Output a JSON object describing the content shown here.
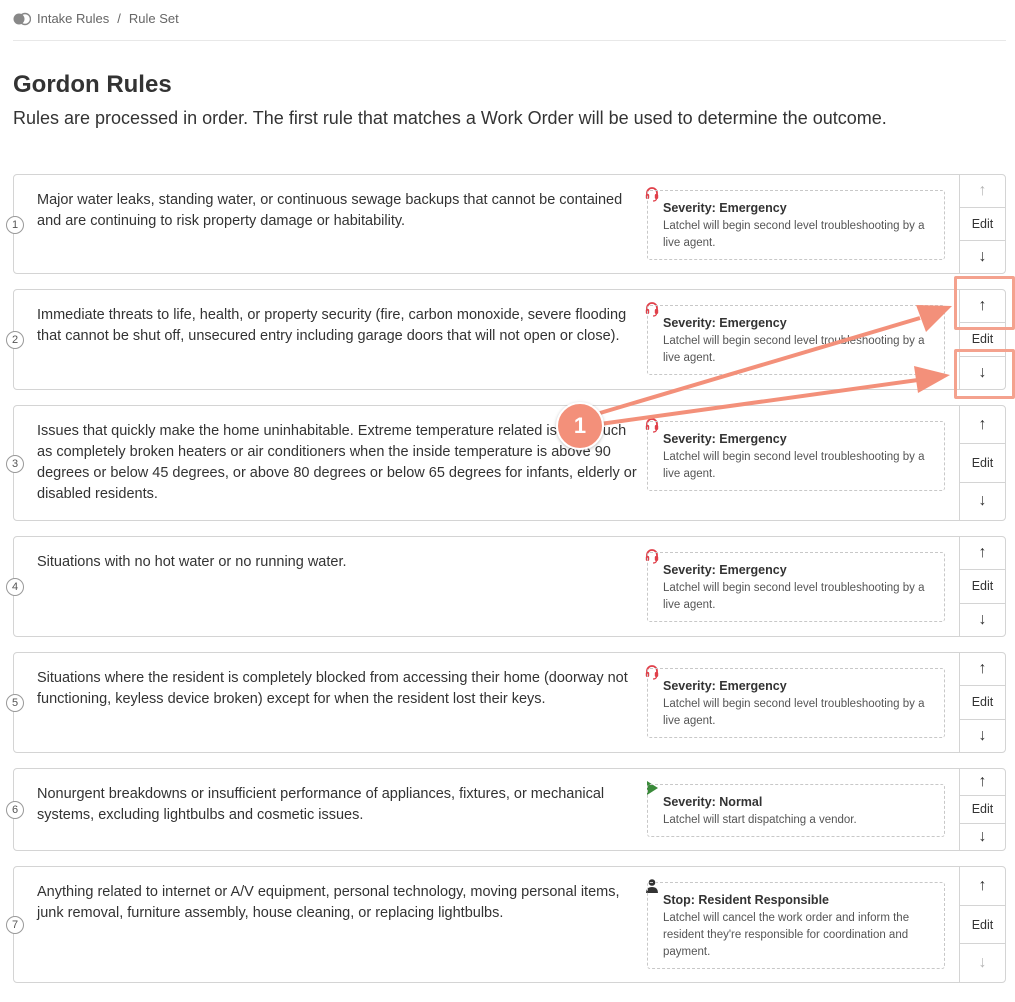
{
  "breadcrumb": {
    "items": [
      "Intake Rules",
      "Rule Set"
    ],
    "separator": "/"
  },
  "page": {
    "title": "Gordon Rules",
    "subtitle": "Rules are processed in order. The first rule that matches a Work Order will be used to determine the outcome."
  },
  "edit_label": "Edit",
  "colors": {
    "emergency": "#e0404a",
    "normal": "#3a8a3a",
    "stop": "#333333",
    "annotation": "#f3907a"
  },
  "rules": [
    {
      "num": "1",
      "desc": "Major water leaks, standing water, or continuous sewage backups that cannot be contained and are continuing to risk property damage or habitability.",
      "icon": "headset-icon",
      "card_title": "Severity: Emergency",
      "card_text": "Latchel will begin second level troubleshooting by a live agent."
    },
    {
      "num": "2",
      "desc": "Immediate threats to life, health, or property security (fire, carbon monoxide, severe flooding that cannot be shut off, unsecured entry including garage doors that will not open or close).",
      "icon": "headset-icon",
      "card_title": "Severity: Emergency",
      "card_text": "Latchel will begin second level troubleshooting by a live agent."
    },
    {
      "num": "3",
      "desc": "Issues that quickly make the home uninhabitable. Extreme temperature related issues, such as completely broken heaters or air conditioners when the inside temperature is above 90 degrees or below 45 degrees, or above 80 degrees or below 65 degrees for infants, elderly or disabled residents.",
      "icon": "headset-icon",
      "card_title": "Severity: Emergency",
      "card_text": "Latchel will begin second level troubleshooting by a live agent."
    },
    {
      "num": "4",
      "desc": "Situations with no hot water or no running water.",
      "icon": "headset-icon",
      "card_title": "Severity: Emergency",
      "card_text": "Latchel will begin second level troubleshooting by a live agent."
    },
    {
      "num": "5",
      "desc": "Situations where the resident is completely blocked from accessing their home (doorway not functioning, keyless device broken) except for when the resident lost their keys.",
      "icon": "headset-icon",
      "card_title": "Severity: Emergency",
      "card_text": "Latchel will begin second level troubleshooting by a live agent."
    },
    {
      "num": "6",
      "desc": "Nonurgent breakdowns or insufficient performance of appliances, fixtures, or mechanical systems, excluding lightbulbs and cosmetic issues.",
      "icon": "play-icon",
      "card_title": "Severity: Normal",
      "card_text": "Latchel will start dispatching a vendor."
    },
    {
      "num": "7",
      "desc": "Anything related to internet or A/V equipment, personal technology, moving personal items, junk removal, furniture assembly, house cleaning, or replacing lightbulbs.",
      "icon": "person-icon",
      "card_title": "Stop: Resident Responsible",
      "card_text": "Latchel will cancel the work order and inform the resident they're responsible for coordination and payment."
    }
  ],
  "annotation": {
    "label": "1"
  }
}
